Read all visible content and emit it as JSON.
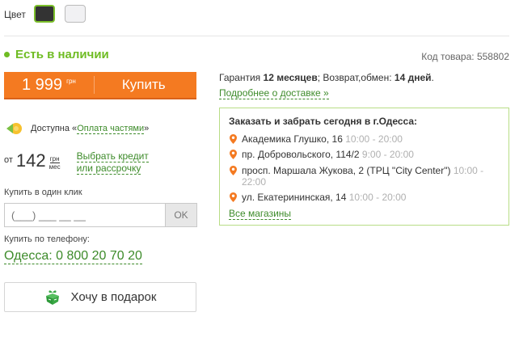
{
  "color": {
    "label": "Цвет",
    "swatches": [
      {
        "name": "dark",
        "hex": "#333333",
        "selected": true
      },
      {
        "name": "light",
        "hex": "#f1f1f3",
        "selected": false
      }
    ]
  },
  "availability": {
    "text": "Есть в наличии",
    "color": "#6fbc23"
  },
  "product_code": "Код товара: 558802",
  "buy": {
    "price": "1 999",
    "currency": "грн",
    "label": "Купить",
    "bg": "#f47a21"
  },
  "installments": {
    "prefix": "Доступна «",
    "link": "Оплата частями",
    "suffix": "»"
  },
  "credit": {
    "from": "от",
    "amount": "142",
    "unit_top": "грн",
    "unit_bottom": "мес",
    "link_line1": "Выбрать кредит",
    "link_line2": "или рассрочку"
  },
  "one_click": {
    "label": "Купить в один клик",
    "placeholder": "(___) ___ __ __",
    "ok": "OK"
  },
  "phone": {
    "label": "Купить по телефону:",
    "number": "Одесса: 0 800 20 70 20"
  },
  "gift": {
    "label": "Хочу в подарок"
  },
  "warranty": {
    "prefix": "Гарантия ",
    "months": "12 месяцев",
    "mid": "; Возврат,обмен: ",
    "days": "14 дней",
    "end": "."
  },
  "delivery_link": "Подробнее о доставке »",
  "pickup": {
    "title": "Заказать и забрать сегодня в г.Одесса:",
    "stores": [
      {
        "address": "Академика Глушко, 16 ",
        "hours": "10:00 - 20:00"
      },
      {
        "address": "пр. Добровольского, 114/2 ",
        "hours": "9:00 - 20:00"
      },
      {
        "address": "просп. Маршала Жукова, 2 (ТРЦ \"City Center\") ",
        "hours": "10:00 - 22:00"
      },
      {
        "address": "ул. Екатерининская, 14 ",
        "hours": "10:00 - 20:00"
      }
    ],
    "all_link": "Все магазины"
  },
  "accent_green": "#3d8b2a"
}
